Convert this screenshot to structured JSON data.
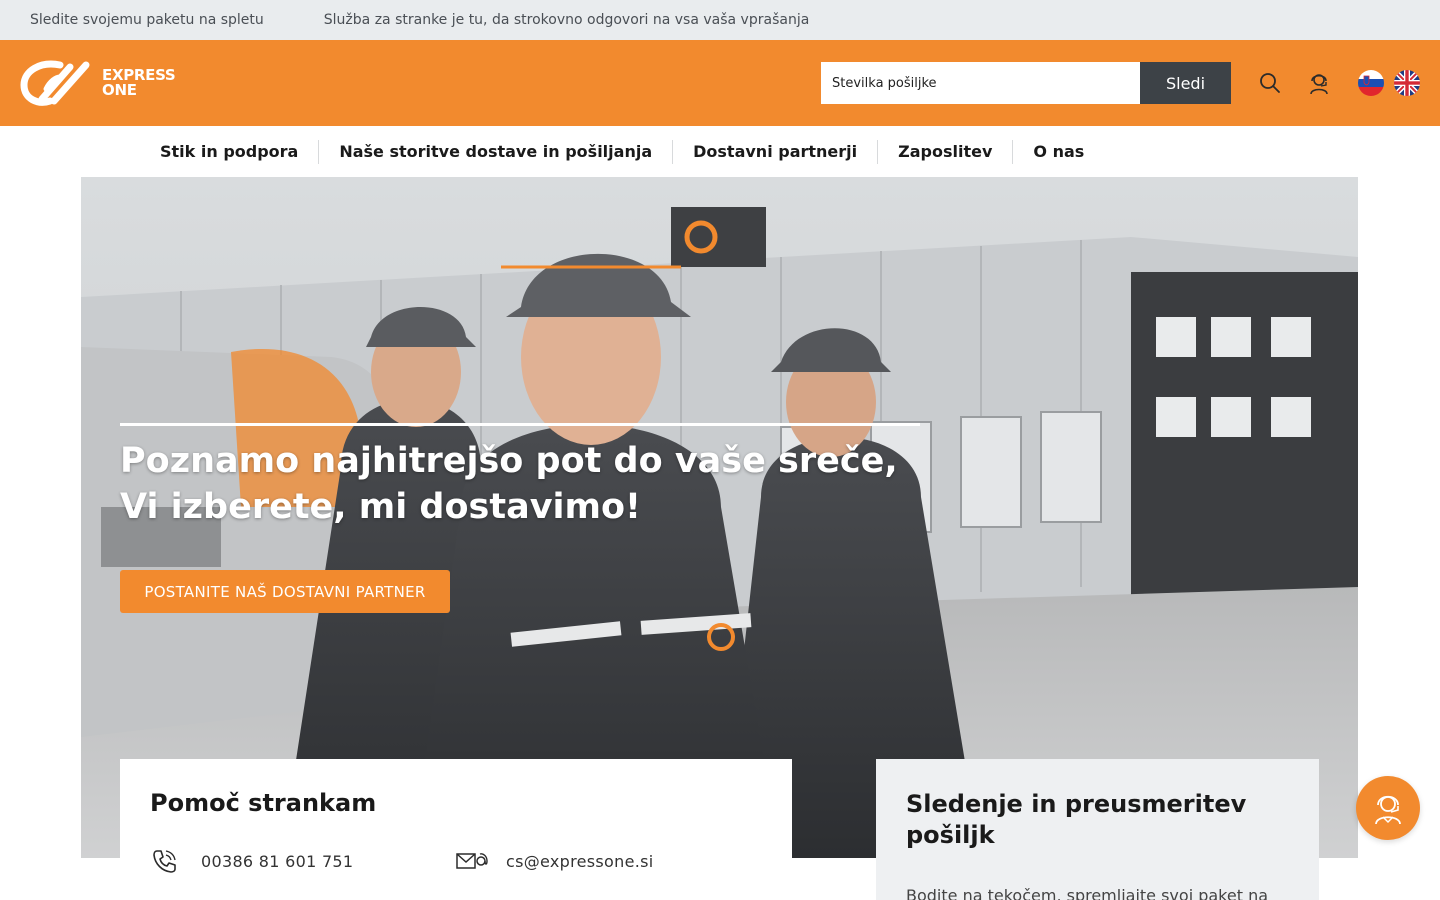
{
  "topbar": {
    "links": [
      "Sledite svojemu paketu na spletu",
      "Služba za stranke je tu, da strokovno odgovori na vsa vaša vprašanja"
    ]
  },
  "header": {
    "logo_text_line1": "EXPRESS",
    "logo_text_line2": "ONE",
    "tracking_placeholder": "Številka pošiljke",
    "tracking_button": "Sledi",
    "icons": [
      "search-icon",
      "support-agent-icon"
    ],
    "languages": [
      "sl",
      "en"
    ]
  },
  "nav": {
    "items": [
      "Stik in podpora",
      "Naše storitve dostave in pošiljanja",
      "Dostavni partnerji",
      "Zaposlitev",
      "O nas"
    ]
  },
  "hero": {
    "title_line1": "Poznamo najhitrejšo pot do vaše sreče,",
    "title_line2": "Vi izberete, mi dostavimo!",
    "cta": "POSTANITE NAŠ DOSTAVNI PARTNER"
  },
  "help_card": {
    "title": "Pomoč strankam",
    "phone": "00386 81 601 751",
    "email": "cs@expressone.si"
  },
  "tracking_card": {
    "title_line1": "Sledenje in preusmeritev",
    "title_line2": "pošiljk",
    "text": "Bodite na tekočem, spremljajte svoj paket na"
  },
  "colors": {
    "brand_orange": "#f28a2e",
    "dark_gray": "#3d4247",
    "topbar_bg": "#e9ecee"
  }
}
